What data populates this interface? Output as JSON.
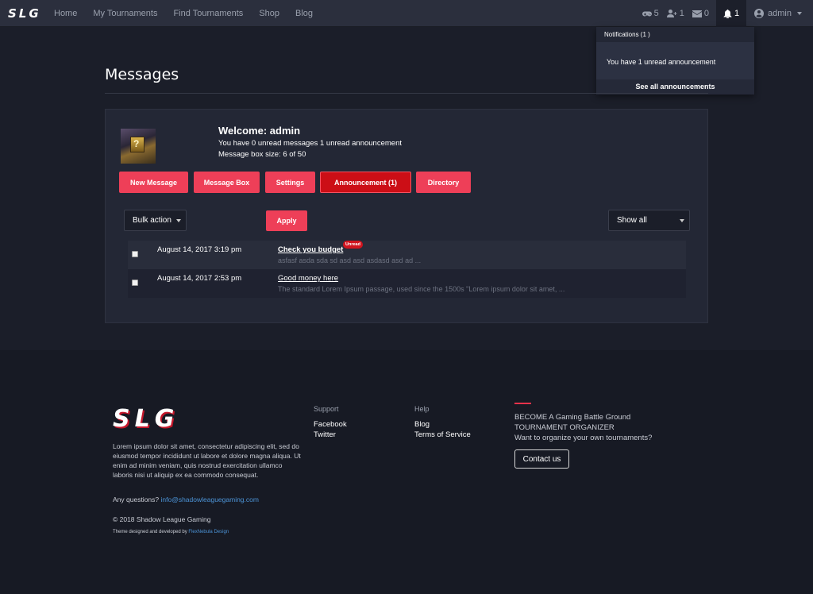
{
  "nav": {
    "brand": "SLG",
    "links": [
      "Home",
      "My Tournaments",
      "Find Tournaments",
      "Shop",
      "Blog"
    ],
    "stats": {
      "games": "5",
      "friends": "1",
      "messages": "0",
      "notifications": "1"
    },
    "user": "admin"
  },
  "notifications": {
    "header": "Notifications (1 )",
    "item": "You have 1 unread announcement",
    "see_all": "See all announcements"
  },
  "page": {
    "title": "Messages"
  },
  "profile": {
    "welcome": "Welcome: admin",
    "unread_info": "You have 0 unread messages 1 unread announcement",
    "box_size": "Message box size: 6 of 50"
  },
  "buttons": {
    "new_message": "New Message",
    "message_box": "Message Box",
    "settings": "Settings",
    "announcement": "Announcement (1)",
    "directory": "Directory"
  },
  "filters": {
    "bulk_action": "Bulk action",
    "apply": "Apply",
    "show": "Show all"
  },
  "messages": [
    {
      "date": "August 14, 2017 3:19 pm",
      "subject": "Check you budget",
      "badge": "Unread",
      "preview": "asfasf asda sda sd asd asd asdasd asd ad ..."
    },
    {
      "date": "August 14, 2017 2:53 pm",
      "subject": "Good money here",
      "preview": "The standard Lorem Ipsum passage, used since the 1500s \"Lorem ipsum dolor sit amet, ..."
    }
  ],
  "footer": {
    "logo": "SLG",
    "lorem": "Lorem ipsum dolor sit amet, consectetur adipiscing elit, sed do eiusmod tempor incididunt ut labore et dolore magna aliqua. Ut enim ad minim veniam, quis nostrud exercitation ullamco laboris nisi ut aliquip ex ea commodo consequat.",
    "questions_label": "Any questions?",
    "email": "info@shadowleaguegaming.com",
    "copyright": "© 2018 Shadow League Gaming",
    "theme_label": "Theme designed and developed by",
    "theme_link": "FlexNebula Design",
    "support_title": "Support",
    "support_links": [
      "Facebook",
      "Twitter"
    ],
    "help_title": "Help",
    "help_links": [
      "Blog",
      "Terms of Service"
    ],
    "become_line1": "BECOME A Gaming Battle Ground",
    "become_line2": "TOURNAMENT ORGANIZER",
    "become_line3": "Want to organize your own tournaments?",
    "contact": "Contact us"
  },
  "colors": {
    "accent": "#ee3f58",
    "accent_active": "#cc0e16",
    "background": "#1b1e29",
    "panel": "#232735",
    "link": "#4b93d6"
  }
}
